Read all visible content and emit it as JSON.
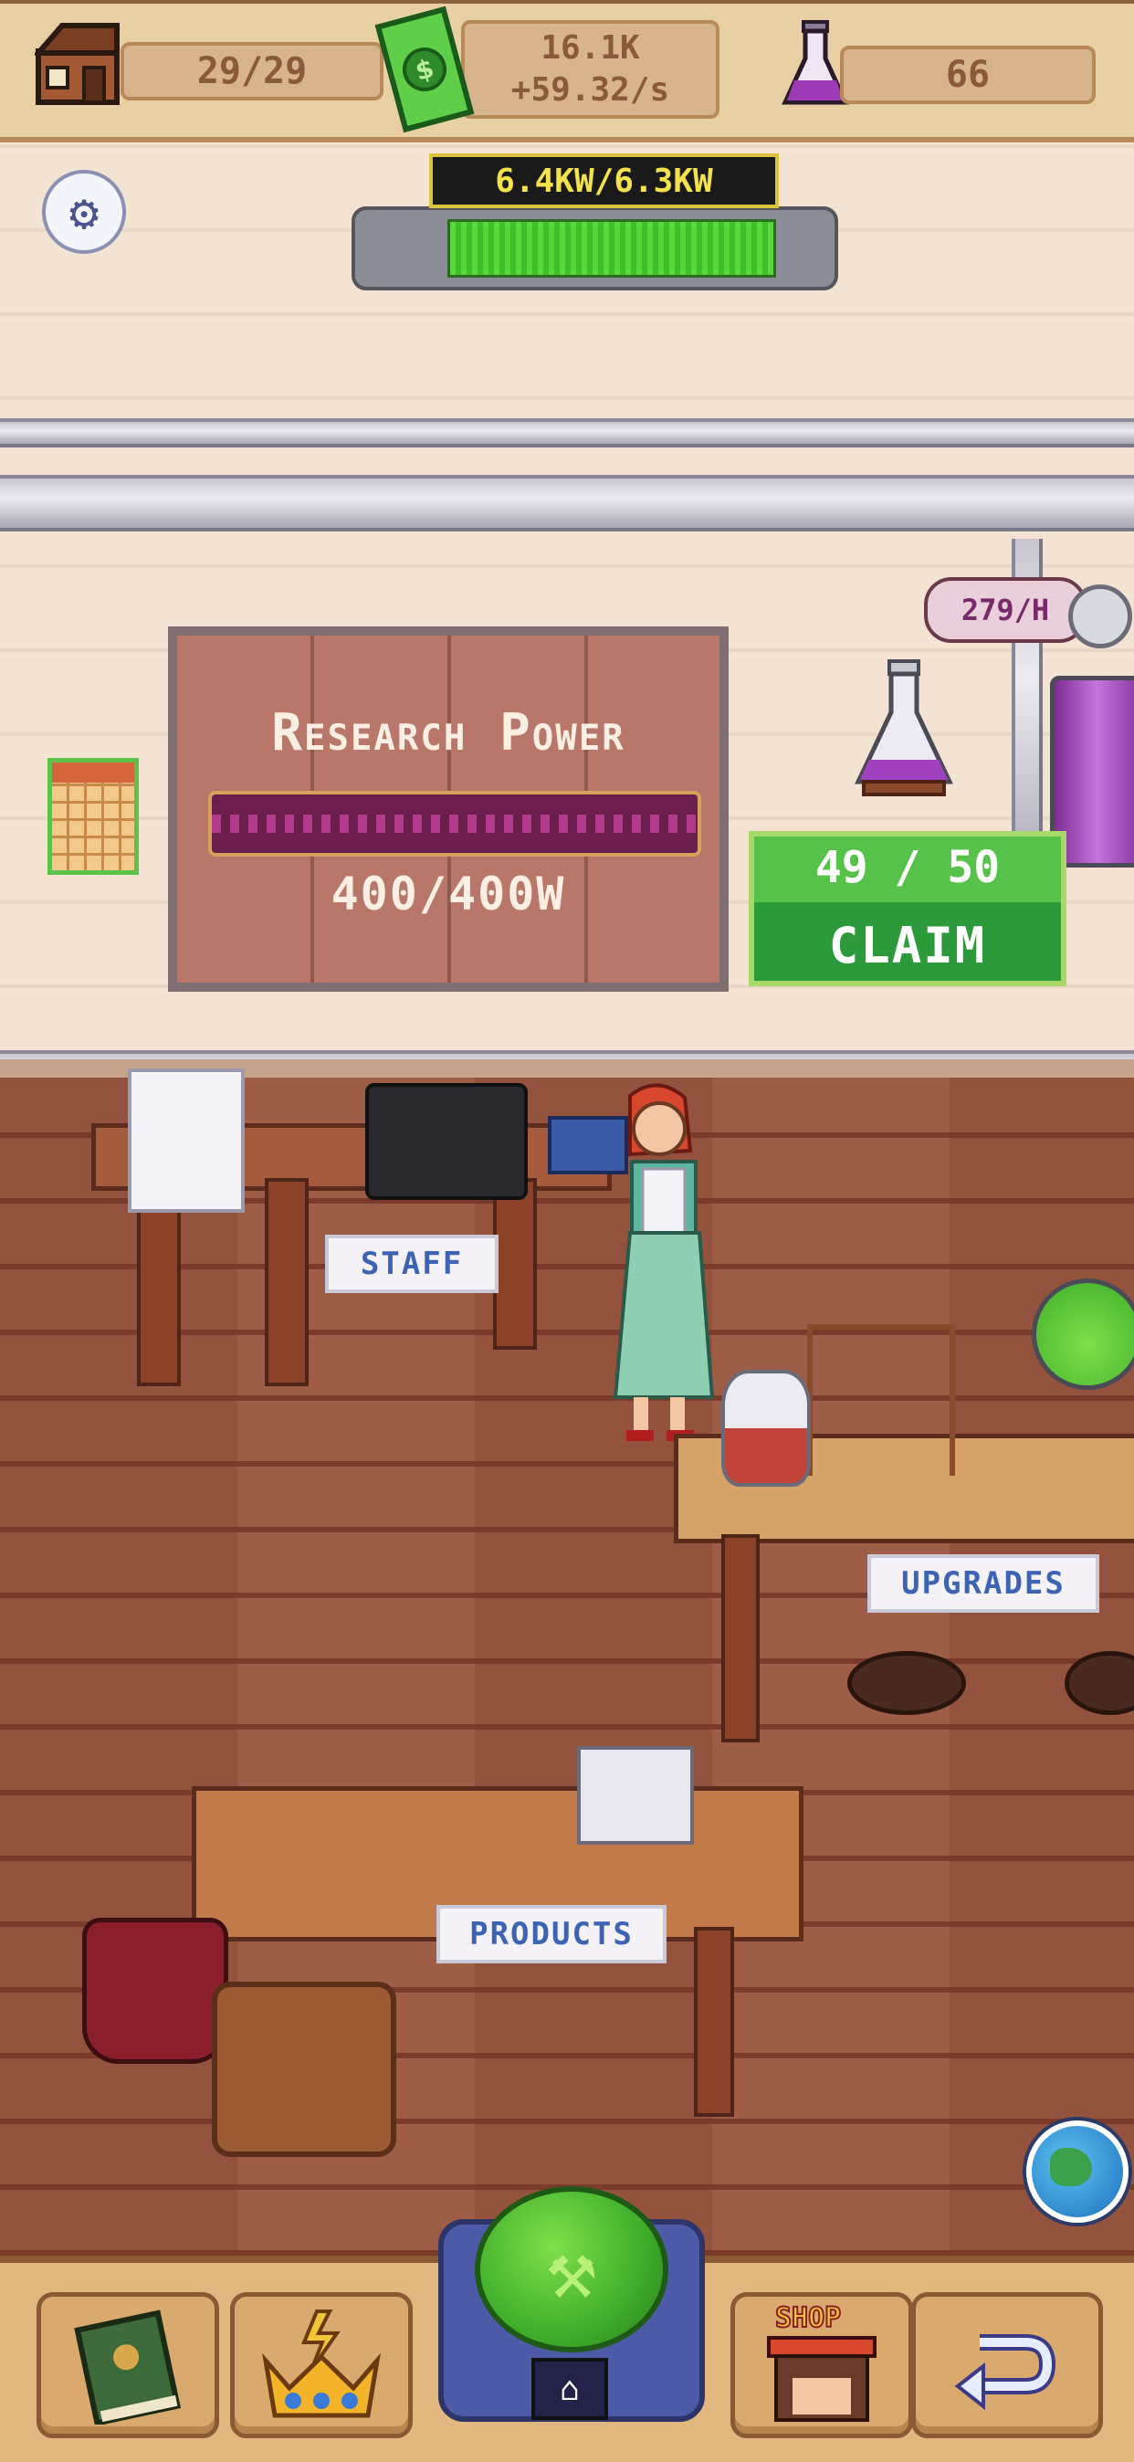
{
  "top_bar": {
    "buildings": "29/29",
    "money_total": "16.1K",
    "money_rate": "+59.32/s",
    "research_points": "66"
  },
  "power": {
    "label": "6.4KW/6.3KW",
    "fill_fraction": 1.0
  },
  "research_board": {
    "title": "Research Power",
    "value": "400/400W"
  },
  "lab": {
    "rate": "279/H"
  },
  "claim": {
    "count": "49 / 50",
    "label": "CLAIM"
  },
  "stations": {
    "staff": "STAFF",
    "upgrades": "UPGRADES",
    "products": "PRODUCTS"
  },
  "bottom_nav": {
    "shop_label": "SHOP"
  },
  "colors": {
    "claim_green": "#2c9a3a",
    "power_fill": "#4fcf32",
    "research_wave": "#b23a8c",
    "sign_text": "#3d64b4"
  }
}
